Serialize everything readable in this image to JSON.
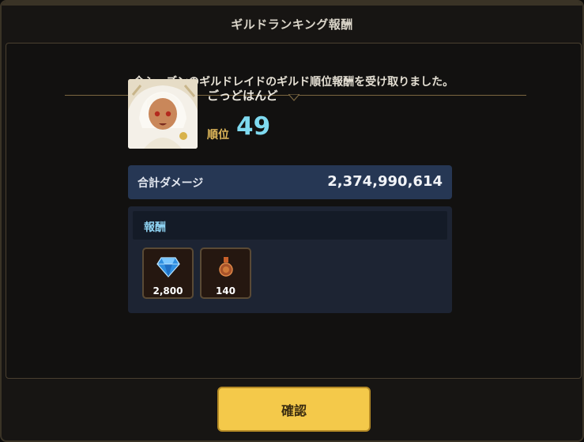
{
  "dialog": {
    "title": "ギルドランキング報酬",
    "message": "今シーズンのギルドレイドのギルド順位報酬を受け取りました。"
  },
  "player": {
    "name": "ごっどはんど",
    "rank_label": "順位",
    "rank_value": "49",
    "avatar_icon": "character-portrait-icon"
  },
  "damage": {
    "label": "合計ダメージ",
    "value": "2,374,990,614"
  },
  "rewards": {
    "header": "報酬",
    "items": [
      {
        "icon": "diamond-icon",
        "quantity": "2,800"
      },
      {
        "icon": "medal-icon",
        "quantity": "140"
      }
    ]
  },
  "confirm": {
    "label": "確認"
  },
  "colors": {
    "accent_gold": "#f4c94a",
    "rank_blue": "#7fdaf0",
    "damage_bar": "#263754"
  }
}
